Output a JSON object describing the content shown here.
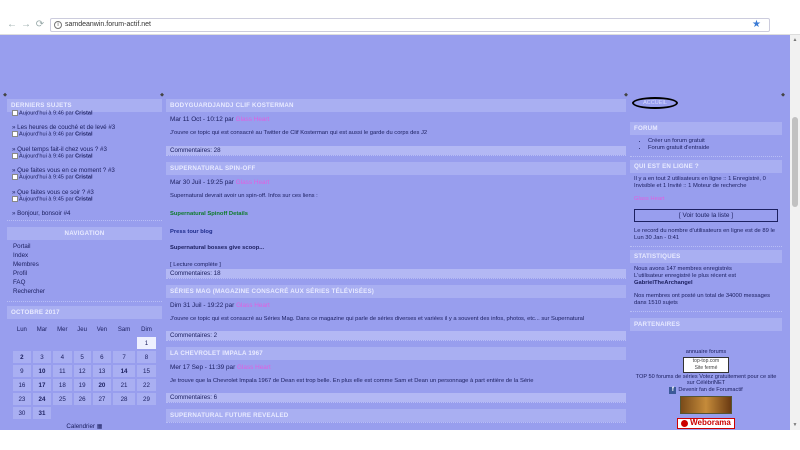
{
  "browser": {
    "url": "samdeanwin.forum-actif.net"
  },
  "sidebar": {
    "recent_title": "DERNIERS SUJETS",
    "recent": [
      {
        "title": "",
        "sub": "Aujourd'hui à 9:46 par ",
        "user": "Cristal"
      },
      {
        "title": "» Les heures de couché et de levé #3",
        "sub": "Aujourd'hui à 9:46 par ",
        "user": "Cristal"
      },
      {
        "title": "» Quel temps fait-il chez vous ? #3",
        "sub": "Aujourd'hui à 9:46 par ",
        "user": "Cristal"
      },
      {
        "title": "» Que faites vous en ce moment ? #3",
        "sub": "Aujourd'hui à 9:45 par ",
        "user": "Cristal"
      },
      {
        "title": "» Que faites vous ce soir ? #3",
        "sub": "Aujourd'hui à 9:45 par ",
        "user": "Cristal"
      },
      {
        "title": "» Bonjour, bonsoir #4",
        "sub": "",
        "user": ""
      }
    ],
    "nav_title": "NAVIGATION",
    "nav": [
      "Portail",
      "Index",
      "Membres",
      "Profil",
      "FAQ",
      "Rechercher"
    ],
    "cal_title": "OCTOBRE 2017",
    "cal_days": [
      "Lun",
      "Mar",
      "Mer",
      "Jeu",
      "Ven",
      "Sam",
      "Dim"
    ],
    "cal_weeks": [
      [
        "",
        "",
        "",
        "",
        "",
        "",
        "1"
      ],
      [
        "2",
        "3",
        "4",
        "5",
        "6",
        "7",
        "8"
      ],
      [
        "9",
        "10",
        "11",
        "12",
        "13",
        "14",
        "15"
      ],
      [
        "16",
        "17",
        "18",
        "19",
        "20",
        "21",
        "22"
      ],
      [
        "23",
        "24",
        "25",
        "26",
        "27",
        "28",
        "29"
      ],
      [
        "30",
        "31",
        "",
        "",
        "",
        "",
        ""
      ]
    ],
    "cal_link": "Calendrier"
  },
  "posts": [
    {
      "title": "BODYGUARDJANDJ CLIF KOSTERMAN",
      "date": "Mar 11 Oct - 10:12 par ",
      "author": "Glass Heart",
      "body": "J'ouvre ce topic qui est consacré au Twitter de Clif Kosterman qui est aussi le garde du corps des J2",
      "comments": "Commentaires: 28"
    },
    {
      "title": "SUPERNATURAL SPIN-OFF",
      "date": "Mar 30 Juil - 19:25 par ",
      "author": "Glass Heart",
      "body": "Supernatural devrait avoir un spin-off. Infos sur ces liens :",
      "links": [
        "Supernatural Spinoff Details",
        "Press tour blog",
        "Supernatural bosses give scoop..."
      ],
      "readmore": "[ Lecture complète ]",
      "comments": "Commentaires: 18"
    },
    {
      "title": "SÉRIES MAG (MAGAZINE CONSACRÉ AUX SÉRIES TÉLÉVISÉES)",
      "date": "Dim 31 Juil - 19:22 par ",
      "author": "Glass Heart",
      "body": "J'ouvre ce topic qui est consacré au Séries Mag. Dans ce magazine qui parle de séries diverses et variées il y a souvent des infos, photos, etc... sur Supernatural",
      "comments": "Commentaires: 2"
    },
    {
      "title": "LA CHEVROLET IMPALA 1967",
      "date": "Mer 17 Sep - 11:39 par ",
      "author": "Glass Heart",
      "body": "Je trouve que la Chevrolet Impala 1967 de Dean est trop belle. En plus elle est comme Sam et Dean un personnage à part entière de la Série",
      "comments": "Commentaires: 6"
    },
    {
      "title": "SUPERNATURAL FUTURE REVEALED",
      "date": "",
      "author": "",
      "body": "",
      "comments": ""
    }
  ],
  "right": {
    "logo": "ACCUEIL",
    "forum_title": "FORUM",
    "forum_links": [
      "Créer un forum gratuit",
      "Forum gratuit d'entraide"
    ],
    "online_title": "QUI EST EN LIGNE ?",
    "online_text": "Il y a en tout 2 utilisateurs en ligne :: 1 Enregistré, 0 Invisible et 1 Invité :: 1 Moteur de recherche",
    "online_user": "Glass Heart",
    "online_button": "[ Voir toute la liste ]",
    "record": "Le record du nombre d'utilisateurs en ligne est de 89 le Lun 30 Jan - 0:41",
    "stats_title": "STATISTIQUES",
    "stats1": "Nous avons 147 membres enregistrés",
    "stats2": "L'utilisateur enregistré le plus récent est",
    "stats_user": "GabrielTheArchangel",
    "stats3": "Nos membres ont posté un total de 34000 messages dans 1510 sujets",
    "partners_title": "PARTENAIRES",
    "partner1": "annuaire forums",
    "topsite": "top-top.com",
    "topsite_sub": "Site fermé",
    "partner2": "TOP 50 forums de séries Votez gratuitement pour ce site sur CélébriNET",
    "fb_text": "Devenir fan de Forumactif",
    "weborama": "Weborama"
  },
  "colors": {
    "background": "#989eee",
    "header": "#a9aff2",
    "author": "#e060e0",
    "link_green": "#0d7a2a"
  }
}
